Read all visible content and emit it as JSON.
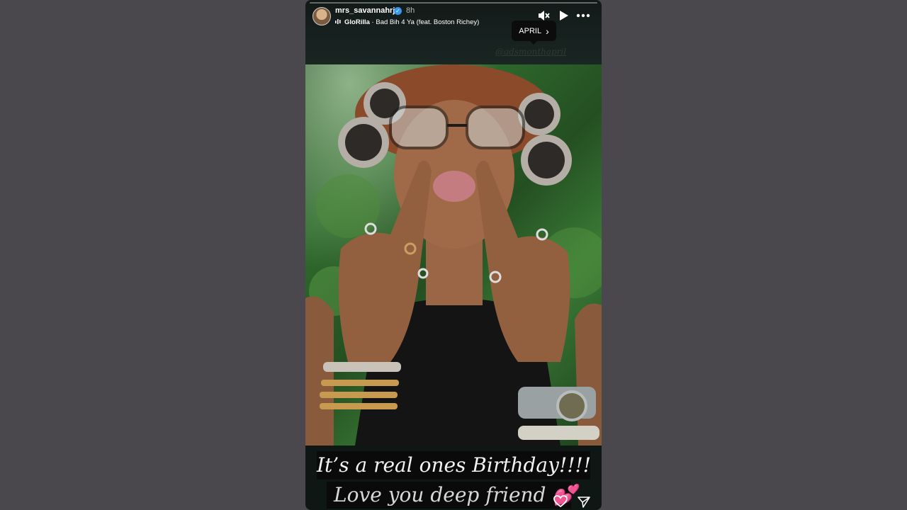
{
  "story": {
    "username": "mrs_savannahrj",
    "time_ago": "8h",
    "verified_glyph": "✓",
    "music": {
      "artist": "GloRilla",
      "separator": " · ",
      "track": "Bad Bih 4 Ya (feat. Boston Richey)"
    },
    "tooltip": {
      "label": "APRIL",
      "chevron": "›"
    },
    "mention": "@adsmonthapril",
    "caption_line1": "It’s a real ones Birthday!!!!",
    "caption_line2": "Love you deep friend 💕",
    "icons": {
      "audio": "audio-bars-icon",
      "verified": "verified-badge-icon",
      "mute": "speaker-muted-icon",
      "play": "play-icon",
      "more": "more-horizontal-icon",
      "heart": "heart-outline-icon",
      "send": "send-icon"
    }
  },
  "colors": {
    "page_bg": "#4a484d",
    "story_bg": "#0f1715",
    "verified_blue": "#3897f0",
    "tooltip_bg": "#0c0c0c"
  }
}
